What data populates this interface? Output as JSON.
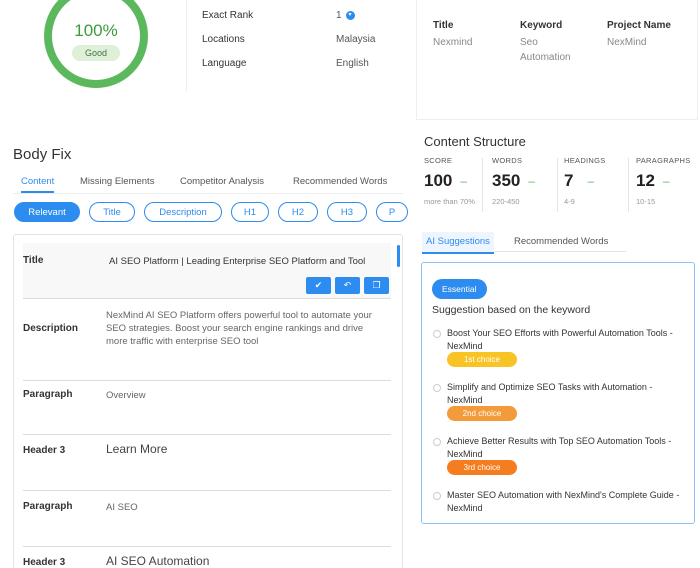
{
  "score_gauge": {
    "value": "100%",
    "status": "Good",
    "color": "#5cb85c"
  },
  "rank_info": [
    {
      "label": "Exact Rank",
      "value": "1"
    },
    {
      "label": "Locations",
      "value": "Malaysia"
    },
    {
      "label": "Language",
      "value": "English"
    }
  ],
  "project": {
    "columns": [
      {
        "header": "Title",
        "value": "Nexmind"
      },
      {
        "header": "Keyword",
        "value": "Seo\nAutomation"
      },
      {
        "header": "Project Name",
        "value": "NexMind"
      }
    ]
  },
  "body_fix": {
    "title": "Body Fix",
    "tabs": [
      "Content",
      "Missing Elements",
      "Competitor Analysis",
      "Recommended Words"
    ],
    "active_tab": "Content",
    "filters": [
      "Relevant",
      "Title",
      "Description",
      "H1",
      "H2",
      "H3",
      "P"
    ],
    "active_filter": "Relevant",
    "rows": [
      {
        "label": "Title",
        "value": "AI SEO Platform | Leading Enterprise SEO Platform and Tool"
      },
      {
        "label": "Description",
        "value": "NexMind AI SEO Platform offers powerful tool to automate your SEO strategies. Boost your search engine rankings and drive more traffic with enterprise SEO tool"
      },
      {
        "label": "Paragraph",
        "value": "Overview"
      },
      {
        "label": "Header 3",
        "value": "Learn More"
      },
      {
        "label": "Paragraph",
        "value": "AI SEO"
      },
      {
        "label": "Header 3",
        "value": "AI SEO Automation"
      }
    ],
    "action_icons": [
      "check-icon",
      "undo-icon",
      "copy-icon"
    ]
  },
  "content_structure": {
    "title": "Content Structure",
    "metrics": [
      {
        "label": "SCORE",
        "value": "100",
        "sub": "more than 70%"
      },
      {
        "label": "WORDS",
        "value": "350",
        "sub": "220-450"
      },
      {
        "label": "HEADINGS",
        "value": "7",
        "sub": "4-9"
      },
      {
        "label": "PARAGRAPHS",
        "value": "12",
        "sub": "10-15"
      }
    ],
    "indicator": "–"
  },
  "suggestions": {
    "tabs": [
      "AI Suggestions",
      "Recommended Words"
    ],
    "active_tab": "AI Suggestions",
    "badge": "Essential",
    "heading": "Suggestion based on the keyword",
    "items": [
      {
        "text": "Boost Your SEO Efforts with Powerful Automation Tools - NexMind",
        "choice": "1st choice",
        "color": "#f7c325"
      },
      {
        "text": "Simplify and Optimize SEO Tasks with Automation - NexMind",
        "choice": "2nd choice",
        "color": "#f39a3b"
      },
      {
        "text": "Achieve Better Results with Top SEO Automation Tools - NexMind",
        "choice": "3rd choice",
        "color": "#f57c1f"
      },
      {
        "text": "Master SEO Automation with NexMind's Complete Guide - NexMind",
        "choice": "",
        "color": ""
      }
    ]
  },
  "accent_color": "#2d8cf0"
}
